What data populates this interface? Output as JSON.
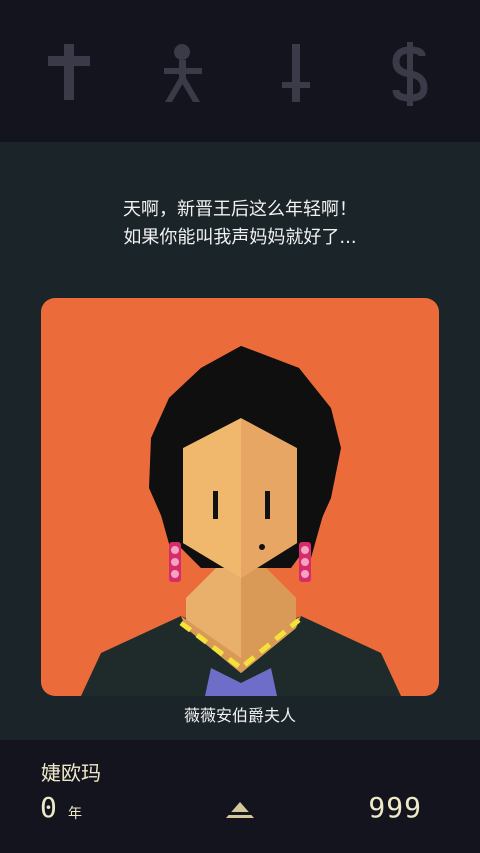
{
  "stats": [
    {
      "icon": "cross-icon",
      "label": "church",
      "level": 0.0
    },
    {
      "icon": "person-icon",
      "label": "people",
      "level": 0.0
    },
    {
      "icon": "sword-icon",
      "label": "army",
      "level": 0.0
    },
    {
      "icon": "dollar-icon",
      "label": "treasury",
      "level": 0.0
    }
  ],
  "dialogue": {
    "line1": "天啊，新晋王后这么年轻啊！",
    "line2": "如果你能叫我声妈妈就好了..."
  },
  "card": {
    "character_name": "薇薇安伯爵夫人",
    "portrait_icon": "countess-portrait",
    "background_color": "#ec6b3a"
  },
  "footer": {
    "ruler_name": "婕欧玛",
    "years_value": "0",
    "years_unit": "年",
    "score_value": "999",
    "expand_icon": "triangle-up-icon"
  },
  "colors": {
    "top_bar": "#14141f",
    "main_bg": "#1b2428",
    "icon_gray": "#3a3a48",
    "text_cream": "#efe9c8",
    "card_orange": "#ec6b3a"
  }
}
